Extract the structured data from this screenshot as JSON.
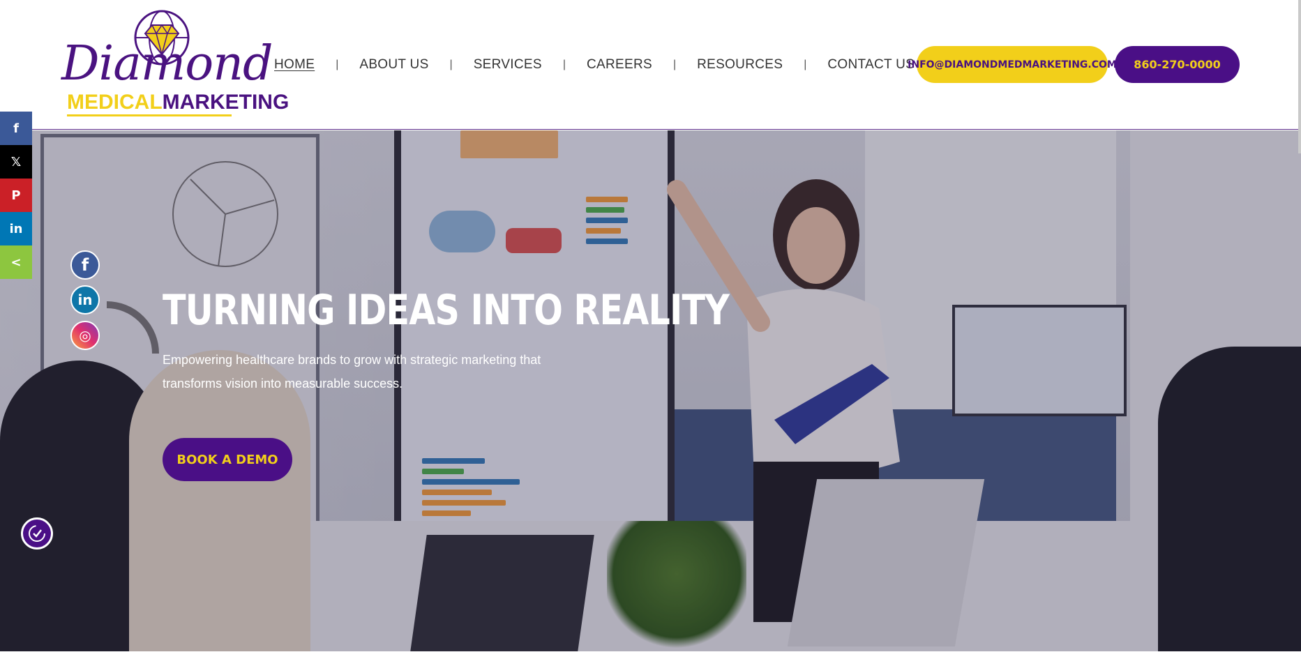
{
  "logo": {
    "diamond": "Diamond",
    "medical": "MEDICAL",
    "marketing": "MARKETING"
  },
  "nav": {
    "items": [
      {
        "label": "HOME",
        "active": true
      },
      {
        "label": "ABOUT US"
      },
      {
        "label": "SERVICES"
      },
      {
        "label": "CAREERS"
      },
      {
        "label": "RESOURCES"
      },
      {
        "label": "CONTACT US"
      }
    ],
    "separator": "|"
  },
  "contact": {
    "email": "INFO@DIAMONDMEDMARKETING.COM",
    "phone": "860-270-0000"
  },
  "hero": {
    "title": "TURNING IDEAS INTO REALITY",
    "text": "Empowering healthcare brands to grow with strategic marketing that transforms vision into measurable success.",
    "cta": "BOOK A DEMO"
  },
  "share_bar": [
    {
      "name": "facebook",
      "glyph": "f",
      "color": "#3b5998"
    },
    {
      "name": "x",
      "glyph": "𝕏",
      "color": "#000000"
    },
    {
      "name": "pinterest",
      "glyph": "P",
      "color": "#cb2027"
    },
    {
      "name": "linkedin",
      "glyph": "in",
      "color": "#0077b5"
    },
    {
      "name": "share",
      "glyph": "<",
      "color": "#8dc63f"
    }
  ],
  "social_circles": [
    {
      "name": "facebook",
      "glyph": "f"
    },
    {
      "name": "linkedin",
      "glyph": "in"
    },
    {
      "name": "instagram",
      "glyph": "◎"
    }
  ],
  "colors": {
    "brand_purple": "#4a0f86",
    "brand_yellow": "#f2cf1a"
  }
}
